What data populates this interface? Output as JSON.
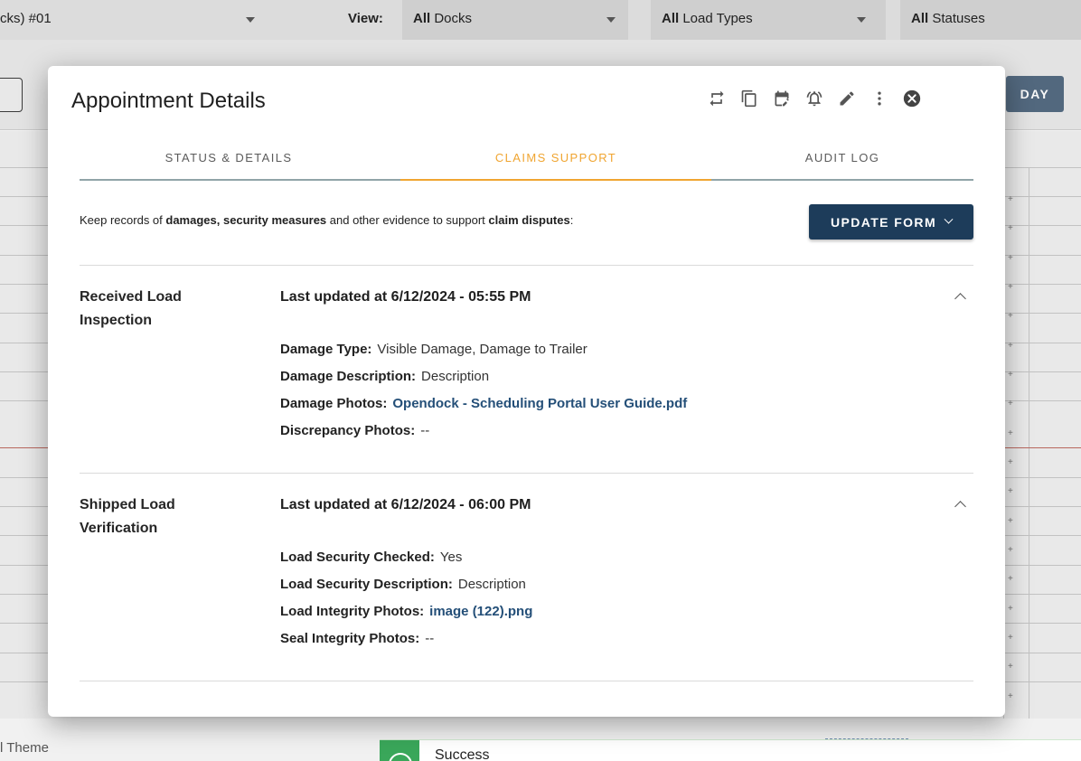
{
  "app": {
    "dock_selector_partial": "cks) #01",
    "view_label": "View:",
    "dock_filter": {
      "bold": "All",
      "rest": "Docks"
    },
    "load_type_filter": {
      "bold": "All",
      "rest": "Load Types"
    },
    "status_filter": {
      "bold": "All",
      "rest": "Statuses"
    },
    "day_button": "DAY",
    "theme_text_partial": "l Theme",
    "toast_title": "Success"
  },
  "modal": {
    "title": "Appointment Details",
    "header_icons": [
      "reschedule-icon",
      "copy-icon",
      "edit-calendar-icon",
      "alarm-icon",
      "pencil-icon",
      "more-vert-icon",
      "close-icon"
    ],
    "tabs": [
      {
        "label": "STATUS & DETAILS",
        "active": false
      },
      {
        "label": "CLAIMS SUPPORT",
        "active": true
      },
      {
        "label": "AUDIT LOG",
        "active": false
      }
    ],
    "intro": {
      "t1": "Keep records of ",
      "b1": "damages, security measures",
      "t2": " and other evidence to support ",
      "b2": "claim disputes",
      "t3": ":"
    },
    "update_button": "UPDATE FORM",
    "sections": [
      {
        "label": "Received Load Inspection",
        "updated": "Last updated at 6/12/2024 - 05:55 PM",
        "fields": [
          {
            "key": "Damage Type:",
            "value": "Visible Damage, Damage to Trailer",
            "link": false
          },
          {
            "key": "Damage Description:",
            "value": "Description",
            "link": false
          },
          {
            "key": "Damage Photos:",
            "value": "Opendock - Scheduling Portal User Guide.pdf",
            "link": true
          },
          {
            "key": "Discrepancy Photos:",
            "value": "--",
            "link": false
          }
        ]
      },
      {
        "label": "Shipped Load Verification",
        "updated": "Last updated at 6/12/2024 - 06:00 PM",
        "fields": [
          {
            "key": "Load Security Checked:",
            "value": "Yes",
            "link": false
          },
          {
            "key": "Load Security Description:",
            "value": "Description",
            "link": false
          },
          {
            "key": "Load Integrity Photos:",
            "value": "image (122).png",
            "link": true
          },
          {
            "key": "Seal Integrity Photos:",
            "value": "--",
            "link": false
          }
        ]
      }
    ]
  },
  "colors": {
    "accent_orange": "#f0a531",
    "primary_navy": "#1d3c5a",
    "link_blue": "#244f78",
    "success_green": "#3aa75a"
  }
}
